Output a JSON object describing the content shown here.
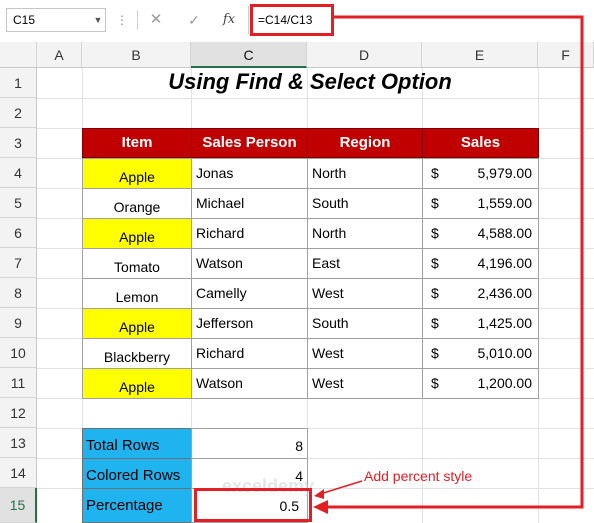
{
  "formula_bar": {
    "name_box": "C15",
    "dots_glyph": "⋮",
    "cancel_glyph": "✕",
    "confirm_glyph": "✓",
    "fx_label": "fx",
    "formula": "=C14/C13"
  },
  "columns": [
    "A",
    "B",
    "C",
    "D",
    "E",
    "F"
  ],
  "selected_column": "C",
  "rows": [
    "1",
    "2",
    "3",
    "4",
    "5",
    "6",
    "7",
    "8",
    "9",
    "10",
    "11",
    "12",
    "13",
    "14",
    "15"
  ],
  "selected_row": "15",
  "title": "Using Find & Select Option",
  "table": {
    "headers": [
      "Item",
      "Sales Person",
      "Region",
      "Sales"
    ],
    "rows": [
      {
        "item": "Apple",
        "person": "Jonas",
        "region": "North",
        "currency": "$",
        "sales": "5,979.00",
        "highlight": true
      },
      {
        "item": "Orange",
        "person": "Michael",
        "region": "South",
        "currency": "$",
        "sales": "1,559.00",
        "highlight": false
      },
      {
        "item": "Apple",
        "person": "Richard",
        "region": "North",
        "currency": "$",
        "sales": "4,588.00",
        "highlight": true
      },
      {
        "item": "Tomato",
        "person": "Watson",
        "region": "East",
        "currency": "$",
        "sales": "4,196.00",
        "highlight": false
      },
      {
        "item": "Lemon",
        "person": "Camelly",
        "region": "West",
        "currency": "$",
        "sales": "2,436.00",
        "highlight": false
      },
      {
        "item": "Apple",
        "person": "Jefferson",
        "region": "South",
        "currency": "$",
        "sales": "1,425.00",
        "highlight": true
      },
      {
        "item": "Blackberry",
        "person": "Richard",
        "region": "West",
        "currency": "$",
        "sales": "5,010.00",
        "highlight": false
      },
      {
        "item": "Apple",
        "person": "Watson",
        "region": "West",
        "currency": "$",
        "sales": "1,200.00",
        "highlight": true
      }
    ]
  },
  "summary": [
    {
      "label": "Total Rows",
      "value": "8"
    },
    {
      "label": "Colored Rows",
      "value": "4"
    },
    {
      "label": "Percentage",
      "value": "0.5"
    }
  ],
  "annotation": {
    "text": "Add percent style"
  },
  "watermark": "exceldemy",
  "colors": {
    "header_fill": "#c00000",
    "highlight_fill": "#ffff00",
    "summary_fill": "#1fb4f0",
    "annotation": "#e31e24",
    "selection": "#217346"
  }
}
